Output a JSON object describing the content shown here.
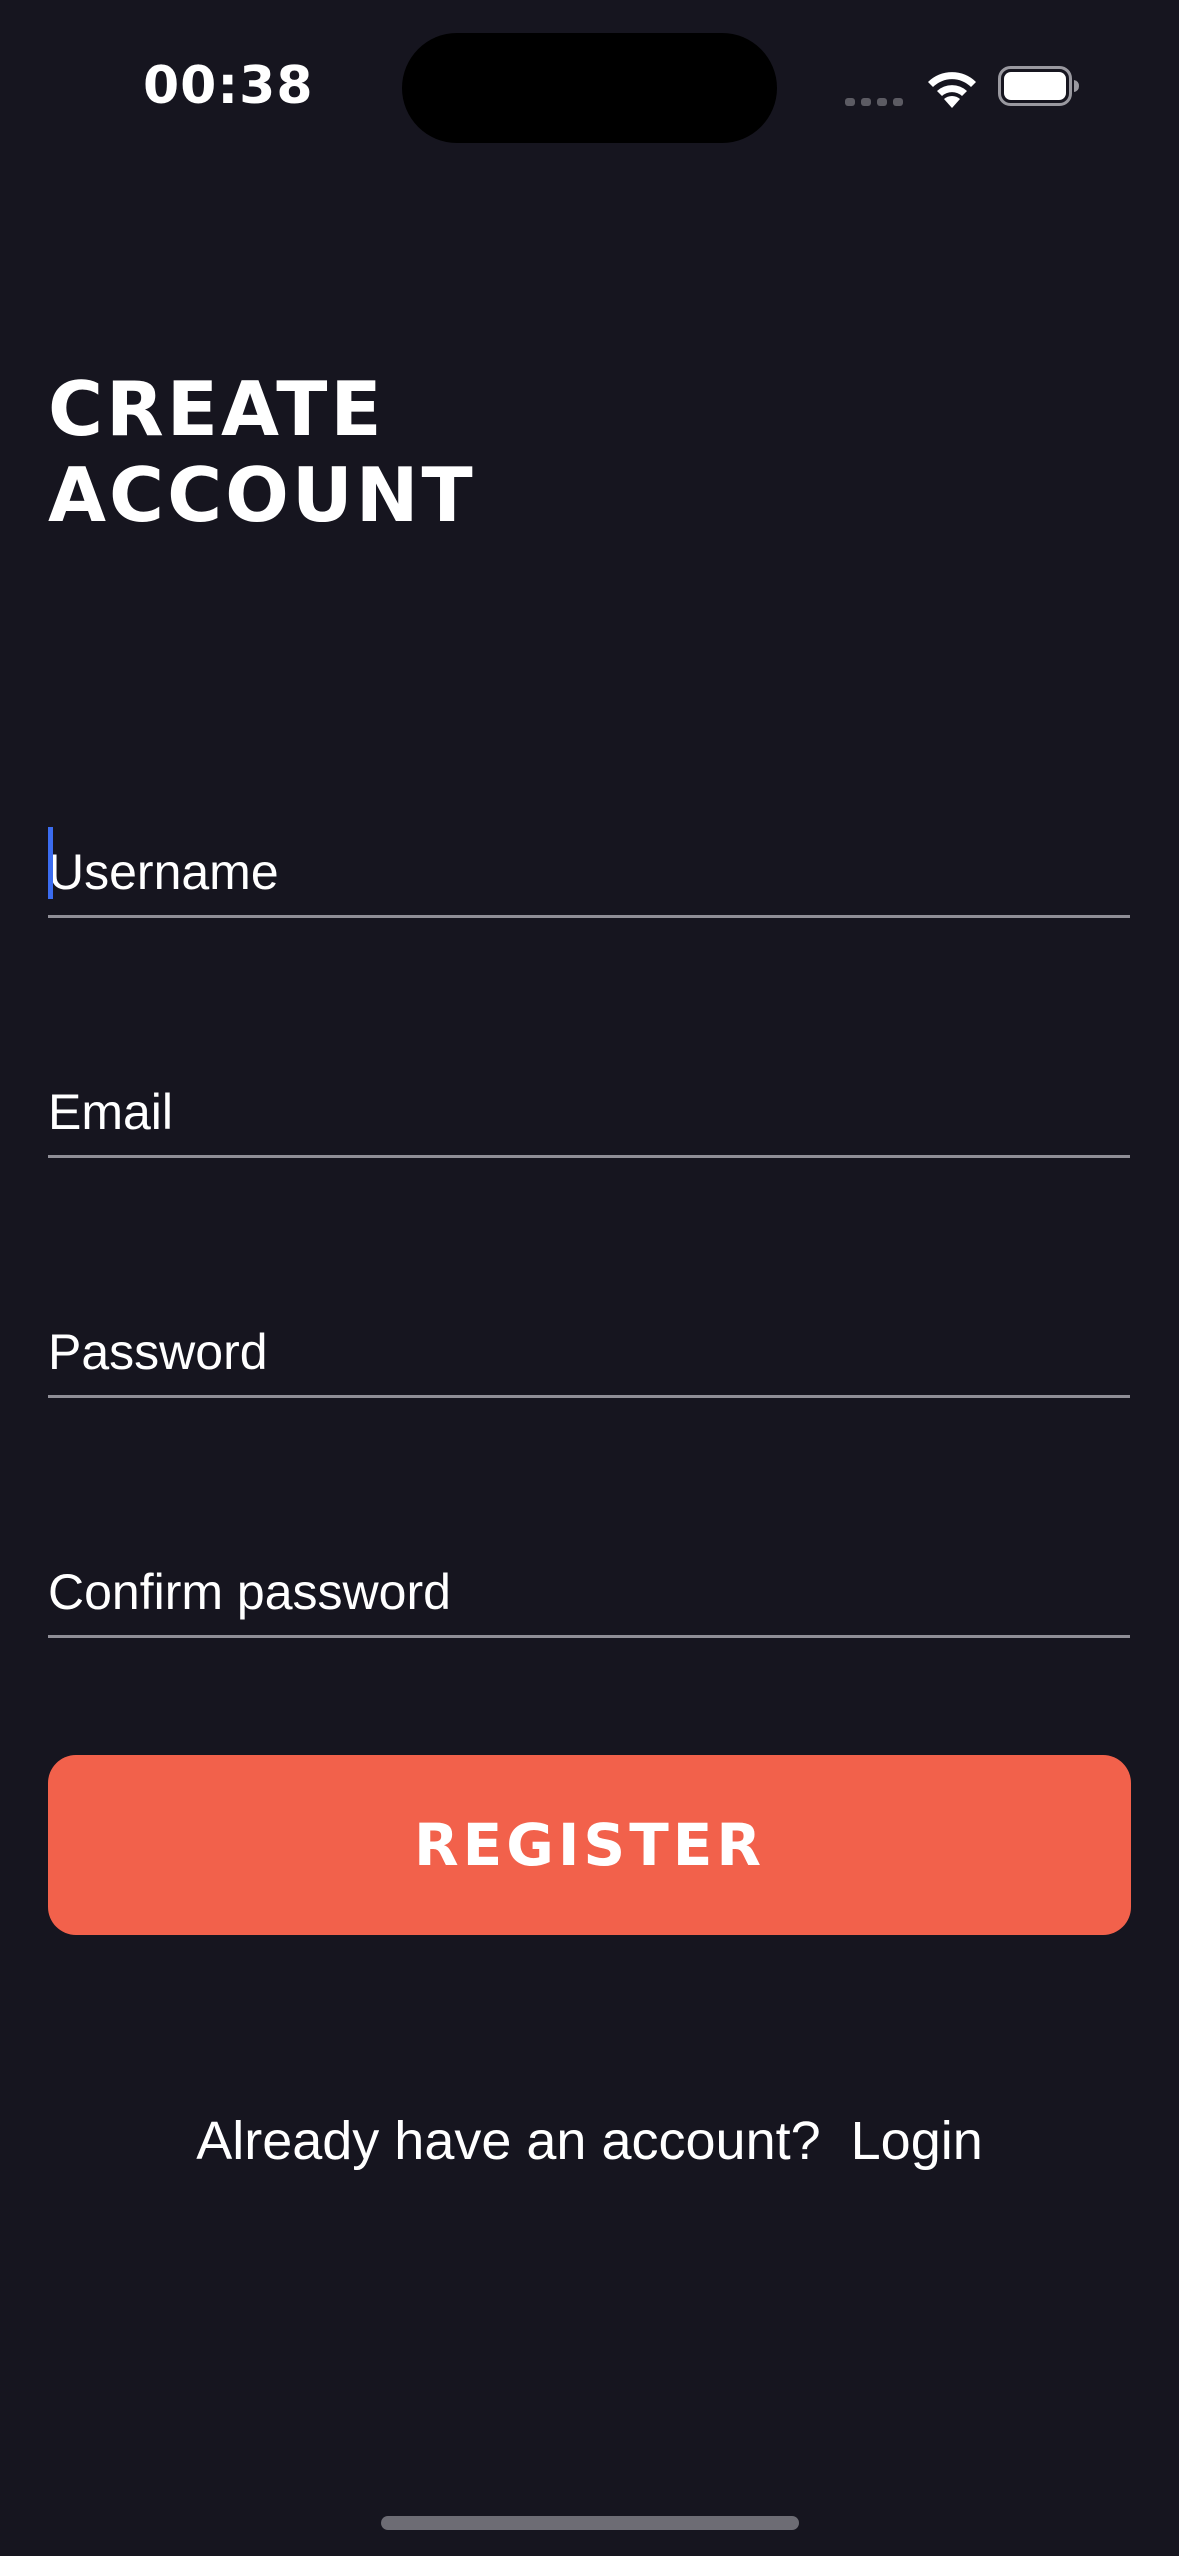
{
  "status_bar": {
    "time": "00:38",
    "icons": [
      "signal-dots-icon",
      "wifi-icon",
      "battery-icon"
    ]
  },
  "page": {
    "title": "CREATE\nACCOUNT"
  },
  "form": {
    "fields": [
      {
        "name": "username",
        "placeholder": "Username",
        "value": "",
        "focused": true
      },
      {
        "name": "email",
        "placeholder": "Email",
        "value": ""
      },
      {
        "name": "password",
        "placeholder": "Password",
        "value": ""
      },
      {
        "name": "confirm_password",
        "placeholder": "Confirm password",
        "value": ""
      }
    ],
    "register_label": "REGISTER"
  },
  "footer": {
    "prompt": "Already have an account?",
    "login_label": "Login"
  },
  "colors": {
    "background": "#16151f",
    "accent": "#f2614b",
    "caret": "#3b6cf0",
    "underline": "#8f8e96"
  }
}
